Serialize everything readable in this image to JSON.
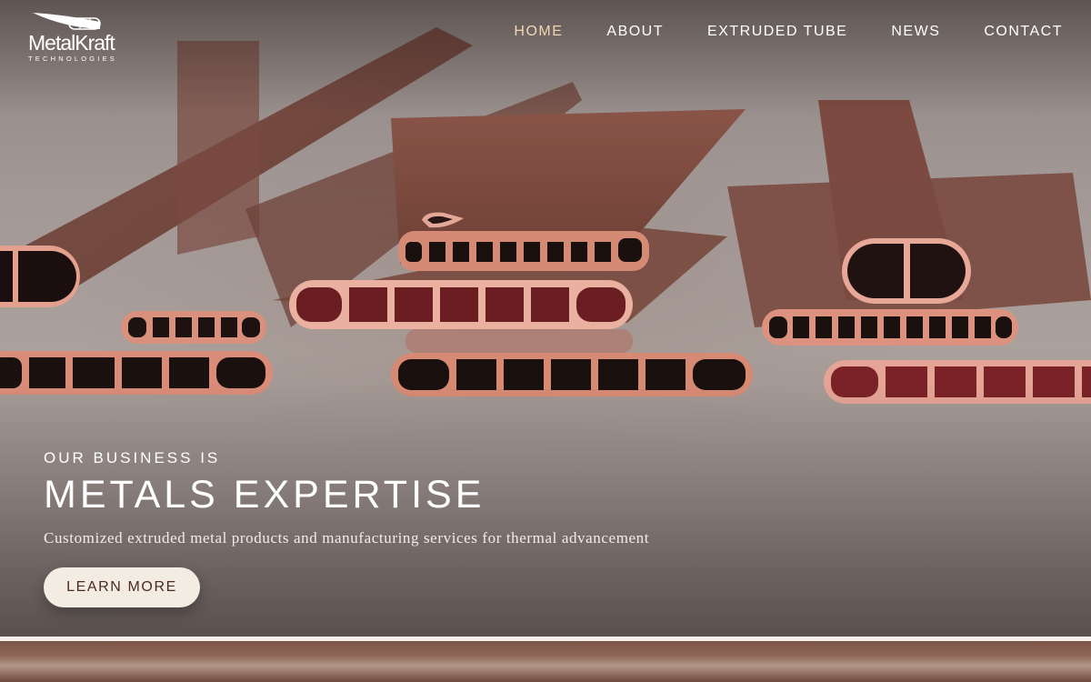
{
  "brand": {
    "name": "MetalKraft",
    "sub": "TECHNOLOGIES",
    "logo_icon": "wing-tube-icon"
  },
  "nav": {
    "items": [
      {
        "label": "HOME",
        "active": true
      },
      {
        "label": "ABOUT",
        "active": false
      },
      {
        "label": "EXTRUDED TUBE",
        "active": false
      },
      {
        "label": "NEWS",
        "active": false
      },
      {
        "label": "CONTACT",
        "active": false
      }
    ]
  },
  "hero": {
    "kicker": "OUR BUSINESS IS",
    "headline": "METALS EXPERTISE",
    "tagline": "Customized extruded metal products and manufacturing services for thermal advancement",
    "cta_label": "LEARN MORE",
    "image": "copper-extruded-tubes-photo"
  },
  "colors": {
    "nav_active": "#f0d6b2",
    "cta_bg": "#f2ece2",
    "cta_text": "#4a2a22",
    "copper": "#9a5a48"
  }
}
